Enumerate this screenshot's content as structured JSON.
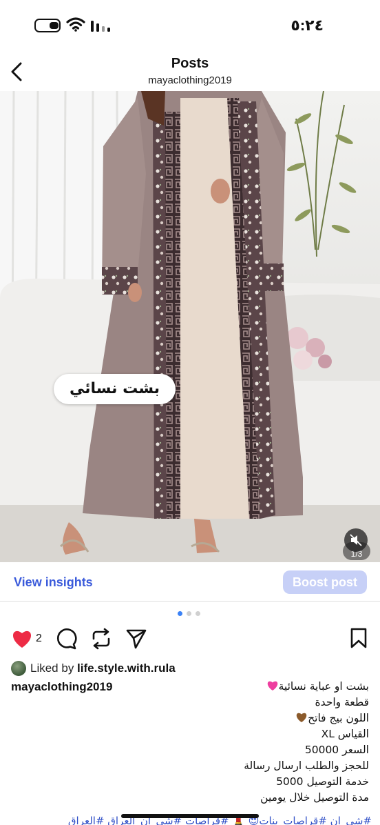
{
  "status_bar": {
    "time": "٥:٢٤"
  },
  "header": {
    "title": "Posts",
    "subtitle": "mayaclothing2019"
  },
  "photo": {
    "overlay_text": "بشت نسائي",
    "page_counter": "1/3"
  },
  "insights": {
    "view_label": "View insights",
    "boost_label": "Boost post"
  },
  "carousel": {
    "active_index": 0,
    "count": 3
  },
  "actions": {
    "like_count": "2"
  },
  "liked_by": {
    "prefix": "Liked by ",
    "user": "life.style.with.rula"
  },
  "caption": {
    "user": "mayaclothing2019",
    "lines": [
      "بشت او عباية نسائية",
      "قطعة واحدة",
      "اللون بيج  فاتح",
      "القياس XL",
      "السعر 50000",
      "للحجز والطلب ارسال رسالة",
      "خدمة التوصيل 5000",
      "مدة التوصيل خلال يومين"
    ],
    "hashtags": "#شي_ان #قراصات_بنات😍 💄 #قراصات #شي_ان_العراق #العراق"
  },
  "colors": {
    "accent_blue": "#3b5bdb",
    "boost_bg": "#c7d0f7",
    "like_red": "#ed2b45",
    "hashtag_blue": "#2f4fc7"
  },
  "icons": [
    "battery-icon",
    "wifi-icon",
    "signal-icon",
    "back-icon",
    "mute-icon",
    "heart-icon",
    "comment-icon",
    "repost-icon",
    "send-icon",
    "bookmark-icon"
  ]
}
